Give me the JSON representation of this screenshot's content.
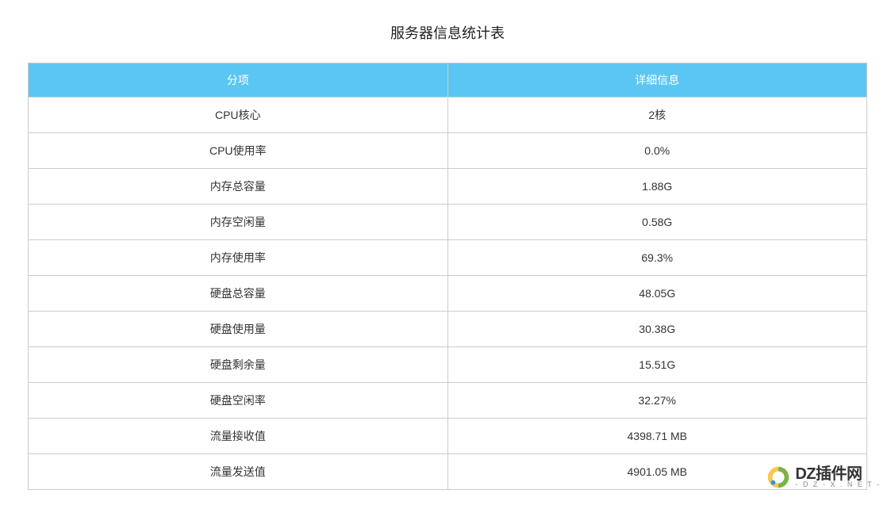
{
  "title": "服务器信息统计表",
  "table": {
    "headers": [
      "分项",
      "详细信息"
    ],
    "rows": [
      {
        "label": "CPU核心",
        "value": "2核"
      },
      {
        "label": "CPU使用率",
        "value": "0.0%"
      },
      {
        "label": "内存总容量",
        "value": "1.88G"
      },
      {
        "label": "内存空闲量",
        "value": "0.58G"
      },
      {
        "label": "内存使用率",
        "value": "69.3%"
      },
      {
        "label": "硬盘总容量",
        "value": "48.05G"
      },
      {
        "label": "硬盘使用量",
        "value": "30.38G"
      },
      {
        "label": "硬盘剩余量",
        "value": "15.51G"
      },
      {
        "label": "硬盘空闲率",
        "value": "32.27%"
      },
      {
        "label": "流量接收值",
        "value": "4398.71 MB"
      },
      {
        "label": "流量发送值",
        "value": "4901.05 MB"
      }
    ]
  },
  "watermark": {
    "brand": "DZ插件网",
    "subtext": "- D Z - X . N E T -"
  }
}
